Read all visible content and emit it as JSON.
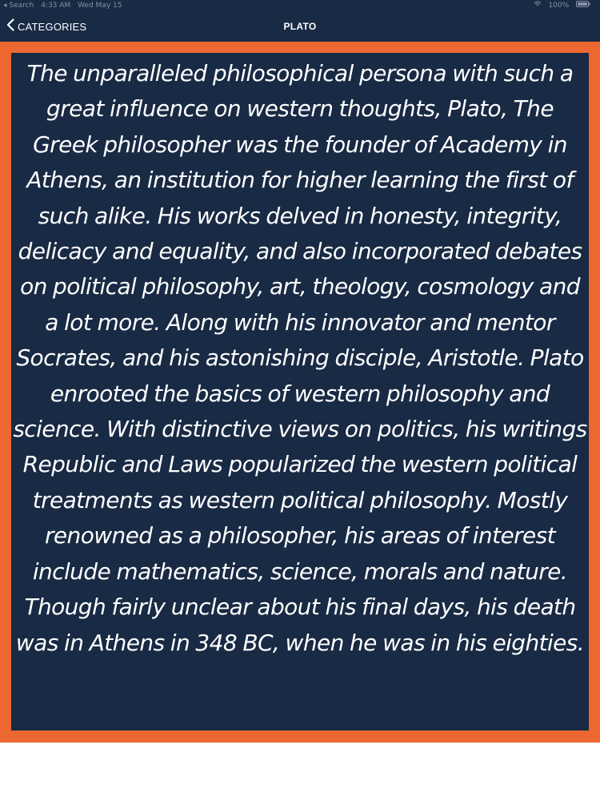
{
  "status_bar": {
    "back_to": "◂ Search",
    "time": "4:33 AM",
    "date": "Wed May 15",
    "battery": "100%"
  },
  "nav": {
    "back_label": "CATEGORIES",
    "title": "PLATO"
  },
  "content": {
    "bio": "The unparalleled philosophical persona with such a great influence on western thoughts, Plato, The Greek philosopher was the founder of Academy in Athens, an institution for higher learning the first of such alike. His works delved in honesty, integrity, delicacy and equality, and also incorporated debates on political philosophy, art, theology, cosmology and a lot more. Along with his innovator and mentor Socrates, and his astonishing disciple, Aristotle. Plato enrooted the basics of western philosophy and science. With distinctive views on politics, his writings Republic and Laws popularized the western political treatments as western political philosophy. Mostly renowned as a philosopher, his areas of interest include mathematics, science, morals and nature. Though fairly unclear about his final days, his death was in Athens in 348 BC, when he was in his eighties."
  },
  "colors": {
    "navy": "#182a44",
    "orange": "#ec6830",
    "text": "#ffffff"
  },
  "icons": {
    "back": "chevron-left-icon",
    "wifi": "wifi-icon",
    "battery": "battery-icon"
  }
}
